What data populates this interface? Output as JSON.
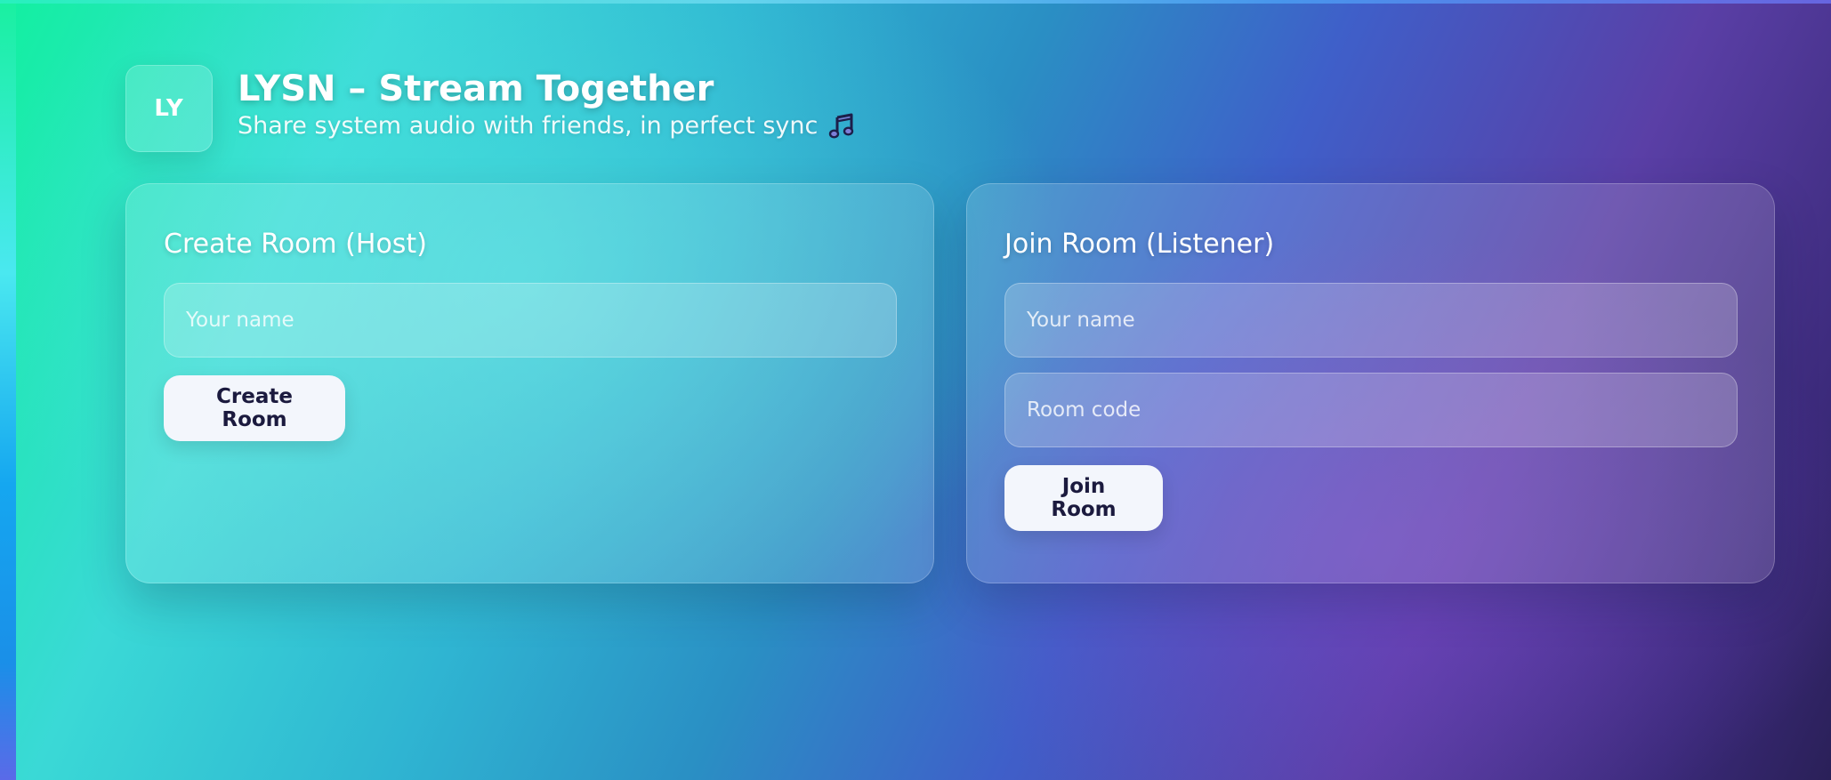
{
  "app": {
    "logo_text": "LY",
    "title": "LYSN – Stream Together",
    "tagline": "Share system audio with friends, in perfect sync",
    "tagline_icon": "music-note-icon"
  },
  "create_room": {
    "title": "Create Room (Host)",
    "name_placeholder": "Your name",
    "name_value": "",
    "button_label": "Create Room"
  },
  "join_room": {
    "title": "Join Room (Listener)",
    "name_placeholder": "Your name",
    "name_value": "",
    "code_placeholder": "Room code",
    "code_value": "",
    "button_label": "Join Room"
  },
  "colors": {
    "button_text": "#1b1a3e",
    "button_bg": "#f3f6fc",
    "gradient_start": "#12f0a0",
    "gradient_mid": "#2a8fc4",
    "gradient_end": "#2a2058"
  }
}
